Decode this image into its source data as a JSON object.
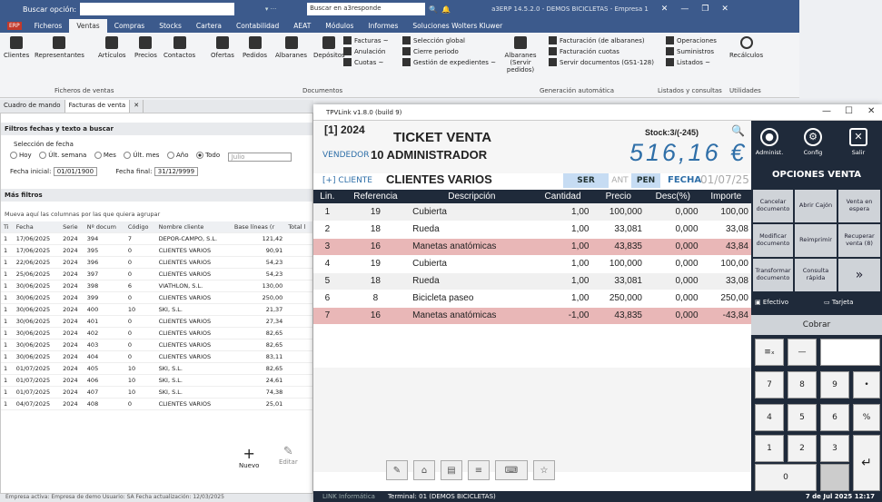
{
  "erp": {
    "search_label": "Buscar opción:",
    "search_a3": "Buscar en a3responde",
    "window_title": "a3ERP 14.5.2.0 - DEMOS BICICLETAS - Empresa 1",
    "badge": "ERP",
    "tabs": [
      "Ficheros",
      "Ventas",
      "Compras",
      "Stocks",
      "Cartera",
      "Contabilidad",
      "AEAT",
      "Módulos",
      "Informes",
      "Soluciones Wolters Kluwer"
    ],
    "ribbon": {
      "big": [
        "Clientes",
        "Representantes",
        "Artículos",
        "Precios",
        "Contactos",
        "Ofertas",
        "Pedidos",
        "Albaranes",
        "Depósitos"
      ],
      "small1": [
        "Facturas ~",
        "Anulación",
        "Cuotas ~"
      ],
      "small2": [
        "Selección global",
        "Cierre periodo",
        "Gestión de expedientes ~"
      ],
      "albaranes_servir": "Albaranes\n(Servir pedidos)",
      "small3": [
        "Facturación (de albaranes)",
        "Facturación cuotas",
        "Servir documentos (GS1-128)"
      ],
      "small4": [
        "Operaciones",
        "Suministros",
        "Listados ~"
      ],
      "recalc": "Recálculos",
      "groups": [
        "Ficheros de ventas",
        "Documentos",
        "Generación automática",
        "Listados y consultas",
        "Utilidades"
      ]
    }
  },
  "left": {
    "tabs": [
      "Cuadro de mando",
      "Facturas de venta"
    ],
    "filtros": "Filtros fechas y texto a buscar",
    "sel_fecha": "Selección de fecha",
    "radios": [
      "Hoy",
      "Últ. semana",
      "Mes",
      "Últ. mes",
      "Año",
      "Todo"
    ],
    "mes_value": "Julio",
    "fecha_inicial_label": "Fecha inicial:",
    "fecha_inicial": "01/01/1900",
    "fecha_final_label": "Fecha final:",
    "fecha_final": "31/12/9999",
    "mas_filtros": "Más filtros",
    "group_hint": "Mueva aquí las columnas por las que quiera agrupar",
    "cols": [
      "Ti",
      "Fecha",
      "Serie",
      "Nº docum",
      "Código",
      "Nombre cliente",
      "Base líneas (r",
      "Total l"
    ],
    "rows": [
      [
        "1",
        "17/06/2025",
        "2024",
        "394",
        "7",
        "DEPOR-CAMPO, S.L.",
        "121,42"
      ],
      [
        "1",
        "17/06/2025",
        "2024",
        "395",
        "0",
        "CLIENTES VARIOS",
        "90,91"
      ],
      [
        "1",
        "22/06/2025",
        "2024",
        "396",
        "0",
        "CLIENTES VARIOS",
        "54,23"
      ],
      [
        "1",
        "25/06/2025",
        "2024",
        "397",
        "0",
        "CLIENTES VARIOS",
        "54,23"
      ],
      [
        "1",
        "30/06/2025",
        "2024",
        "398",
        "6",
        "VIATHLON, S.L.",
        "130,00"
      ],
      [
        "1",
        "30/06/2025",
        "2024",
        "399",
        "0",
        "CLIENTES VARIOS",
        "250,00"
      ],
      [
        "1",
        "30/06/2025",
        "2024",
        "400",
        "10",
        "SKI, S.L.",
        "21,37"
      ],
      [
        "1",
        "30/06/2025",
        "2024",
        "401",
        "0",
        "CLIENTES VARIOS",
        "27,34"
      ],
      [
        "1",
        "30/06/2025",
        "2024",
        "402",
        "0",
        "CLIENTES VARIOS",
        "82,65"
      ],
      [
        "1",
        "30/06/2025",
        "2024",
        "403",
        "0",
        "CLIENTES VARIOS",
        "82,65"
      ],
      [
        "1",
        "30/06/2025",
        "2024",
        "404",
        "0",
        "CLIENTES VARIOS",
        "83,11"
      ],
      [
        "1",
        "01/07/2025",
        "2024",
        "405",
        "10",
        "SKI, S.L.",
        "82,65"
      ],
      [
        "1",
        "01/07/2025",
        "2024",
        "406",
        "10",
        "SKI, S.L.",
        "24,61"
      ],
      [
        "1",
        "01/07/2025",
        "2024",
        "407",
        "10",
        "SKI, S.L.",
        "74,38"
      ],
      [
        "1",
        "04/07/2025",
        "2024",
        "408",
        "0",
        "CLIENTES VARIOS",
        "25,01"
      ]
    ],
    "nuevo": "Nuevo",
    "editar": "Editar",
    "status": "Empresa activa: Empresa de demo  Usuario: SA  Fecha actualización: 12/03/2025"
  },
  "tpv": {
    "title": "TPVLink v1.8.0 (build 9)",
    "year": "[1] 2024",
    "ticket": "TICKET VENTA",
    "stock": "Stock:3/(-245)",
    "vendedor_label": "VENDEDOR",
    "vendedor": "10  ADMINISTRADOR",
    "total": "516,16 €",
    "cliente_label": "[+] CLIENTE",
    "cliente": "CLIENTES VARIOS",
    "ser": "SER",
    "ant": "ANT",
    "pen": "PEN",
    "fecha_label": "FECHA",
    "fecha": "01/07/25",
    "cols": [
      "Lin.",
      "Referencia",
      "Descripción",
      "Cantidad",
      "Precio",
      "Desc(%)",
      "Importe"
    ],
    "lines": [
      {
        "lin": "1",
        "ref": "19",
        "desc": "Cubierta",
        "cant": "1,00",
        "precio": "100,000",
        "desc_pct": "0,000",
        "imp": "100,00",
        "style": "g"
      },
      {
        "lin": "2",
        "ref": "18",
        "desc": "Rueda",
        "cant": "1,00",
        "precio": "33,081",
        "desc_pct": "0,000",
        "imp": "33,08",
        "style": "w"
      },
      {
        "lin": "3",
        "ref": "16",
        "desc": "Manetas anatómicas",
        "cant": "1,00",
        "precio": "43,835",
        "desc_pct": "0,000",
        "imp": "43,84",
        "style": "p"
      },
      {
        "lin": "4",
        "ref": "19",
        "desc": "Cubierta",
        "cant": "1,00",
        "precio": "100,000",
        "desc_pct": "0,000",
        "imp": "100,00",
        "style": "w"
      },
      {
        "lin": "5",
        "ref": "18",
        "desc": "Rueda",
        "cant": "1,00",
        "precio": "33,081",
        "desc_pct": "0,000",
        "imp": "33,08",
        "style": "g"
      },
      {
        "lin": "6",
        "ref": "8",
        "desc": "Bicicleta paseo",
        "cant": "1,00",
        "precio": "250,000",
        "desc_pct": "0,000",
        "imp": "250,00",
        "style": "w"
      },
      {
        "lin": "7",
        "ref": "16",
        "desc": "Manetas anatómicas",
        "cant": "-1,00",
        "precio": "43,835",
        "desc_pct": "0,000",
        "imp": "-43,84",
        "style": "p"
      }
    ],
    "footer_left": "LINK Informática",
    "footer_terminal": "Terminal: 01 (DEMOS BICICLETAS)",
    "footer_date": "7 de Jul 2025 12:17",
    "admin": "Administ.",
    "config": "Config",
    "salir": "Salir",
    "opciones": "OPCIONES VENTA",
    "buttons": [
      "Cancelar documento",
      "Abrir Cajón",
      "Venta en espera",
      "Modificar documento",
      "Reimprimir",
      "Recuperar venta (8)",
      "Transformar documento",
      "Consulta rápida"
    ],
    "efectivo": "Efectivo",
    "tarjeta": "Tarjeta",
    "cobrar": "Cobrar",
    "keys": [
      "7",
      "8",
      "9",
      "•",
      "4",
      "5",
      "6",
      "%",
      "1",
      "2",
      "3",
      "0"
    ]
  }
}
